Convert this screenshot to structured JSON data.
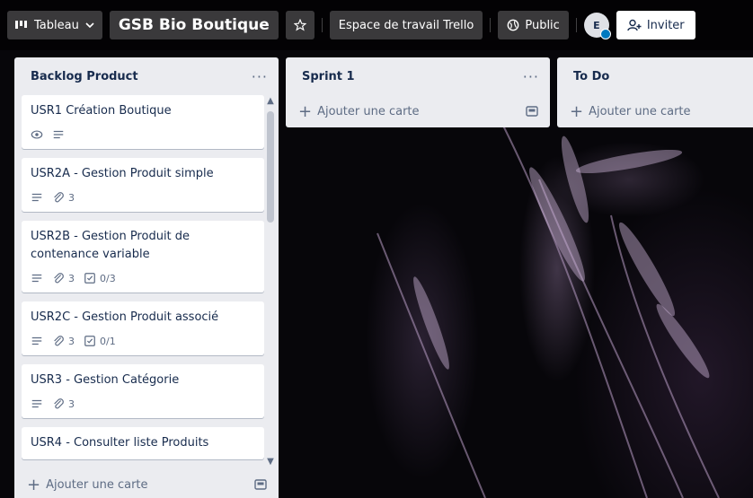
{
  "header": {
    "view_label": "Tableau",
    "board_title": "GSB Bio Boutique",
    "workspace_label": "Espace de travail Trello",
    "visibility_label": "Public",
    "avatar_initial": "E",
    "invite_label": "Inviter"
  },
  "lists": [
    {
      "title": "Backlog Product",
      "add_card": "Ajouter une carte",
      "cards": [
        {
          "title": "USR1 Création Boutique",
          "badges": [
            {
              "icon": "eye-icon"
            },
            {
              "icon": "description-icon"
            }
          ]
        },
        {
          "title": "USR2A - Gestion Produit simple",
          "badges": [
            {
              "icon": "description-icon"
            },
            {
              "icon": "attachment-icon",
              "text": "3"
            }
          ]
        },
        {
          "title": "USR2B - Gestion Produit de contenance variable",
          "badges": [
            {
              "icon": "description-icon"
            },
            {
              "icon": "attachment-icon",
              "text": "3"
            },
            {
              "icon": "checklist-icon",
              "text": "0/3"
            }
          ]
        },
        {
          "title": "USR2C - Gestion Produit associé",
          "badges": [
            {
              "icon": "description-icon"
            },
            {
              "icon": "attachment-icon",
              "text": "3"
            },
            {
              "icon": "checklist-icon",
              "text": "0/1"
            }
          ]
        },
        {
          "title": "USR3 - Gestion Catégorie",
          "badges": [
            {
              "icon": "description-icon"
            },
            {
              "icon": "attachment-icon",
              "text": "3"
            }
          ]
        },
        {
          "title": "USR4 - Consulter liste Produits",
          "badges": []
        }
      ]
    },
    {
      "title": "Sprint 1",
      "add_card": "Ajouter une carte",
      "cards": []
    },
    {
      "title": "To Do",
      "add_card": "Ajouter une carte",
      "cards": []
    }
  ],
  "colors": {
    "list_bg": "#ebecf0",
    "card_bg": "#ffffff",
    "text": "#172b4d",
    "muted": "#5e6c84"
  }
}
